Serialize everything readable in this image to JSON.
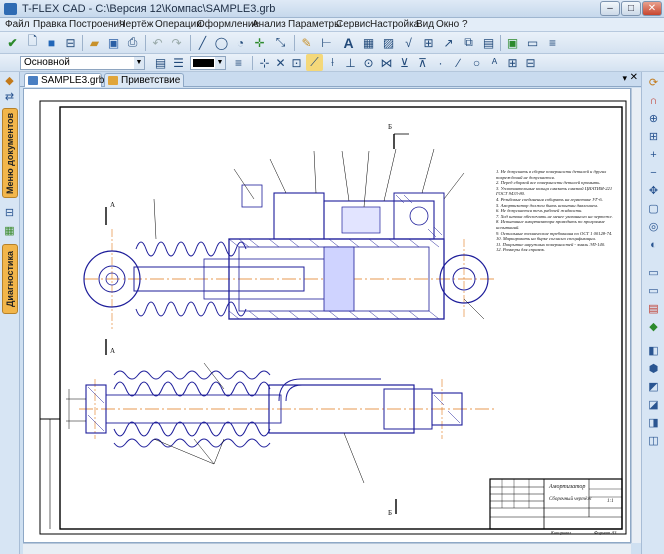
{
  "window": {
    "title": "T-FLEX CAD - C:\\Версия 12\\Компас\\SAMPLE3.grb",
    "minimize": "–",
    "maximize": "□",
    "close": "✕"
  },
  "menu": [
    "Файл",
    "Правка",
    "Построения",
    "Чертёж",
    "Операции",
    "Оформление",
    "Анализ",
    "Параметры",
    "Сервис",
    "Настройка",
    "Вид",
    "Окно",
    "?"
  ],
  "toolbar2": {
    "layer_combo": "Основной",
    "color_hint": "#000000"
  },
  "left_panel": {
    "tabs": [
      "Меню документов",
      "Диагностика"
    ]
  },
  "document_tabs": [
    {
      "label": "SAMPLE3.grb",
      "active": true
    },
    {
      "label": "Приветствие",
      "active": false
    }
  ],
  "drawing": {
    "section_marks": [
      "Б",
      "Б",
      "А",
      "А"
    ],
    "notes": [
      "1. Не допускать в сборке поверхности деталей и других повреждений не допускается.",
      "2. Перед сборкой все поверхности деталей промыть.",
      "3. Уплотнительные кольца смазать смазкой ЦИАТИМ-221 ГОСТ 9433-80.",
      "4. Резьбовые соединения собирать на герметике УГ-6.",
      "5. Амортизатор должен быть испытан давлением.",
      "6. Не допускается течь рабочей жидкости.",
      "7. Ход штока обеспечить не менее указанного на чертеже.",
      "8. Испытание амортизатора проводить по программе испытаний.",
      "9. Остальные технические требования по ОСТ 1 00128-74.",
      "10. Маркировать на бирке согласно спецификации.",
      "11. Покрытие наружных поверхностей - эмаль ЭП-140.",
      "12. Размеры для справок."
    ],
    "stamp": {
      "title": "Амортизатор",
      "subtitle": "Сборочный чертёж",
      "scale": "1:1",
      "format": "Формат  А3",
      "copied": "Копировал"
    }
  }
}
